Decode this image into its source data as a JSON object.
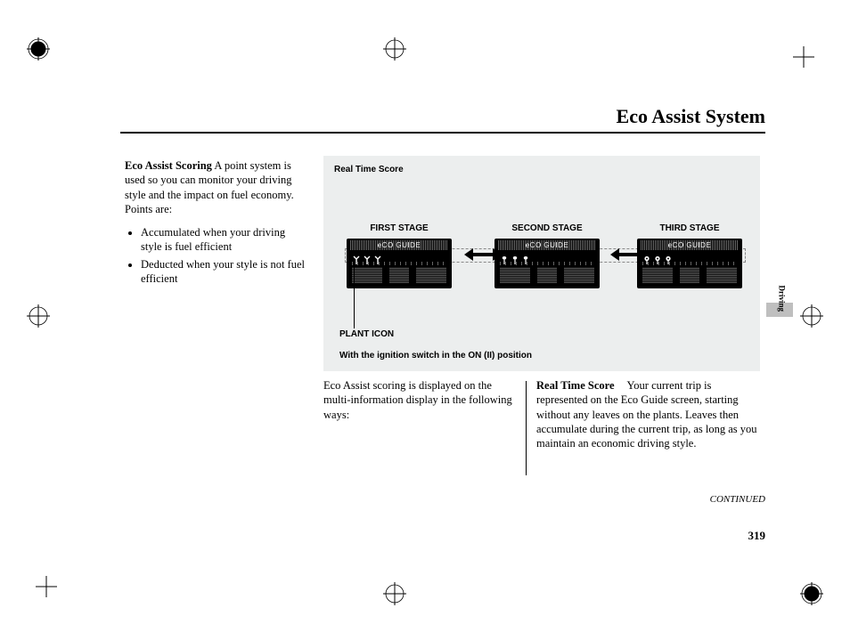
{
  "page": {
    "title": "Eco Assist System",
    "number": "319",
    "continued": "CONTINUED",
    "sideLabel": "Driving"
  },
  "left": {
    "heading": "Eco Assist Scoring",
    "intro": "A point system is used so you can monitor your driving style and the impact on fuel economy. Points are:",
    "bullets": [
      "Accumulated when your driving style is fuel efficient",
      "Deducted when your style is not fuel efficient"
    ]
  },
  "figure": {
    "title": "Real Time Score",
    "stages": [
      "FIRST STAGE",
      "SECOND STAGE",
      "THIRD STAGE"
    ],
    "guideLabel": "eCO GUIDE",
    "plantLabel": "PLANT ICON",
    "caption": "With the ignition switch in the ON (II) position"
  },
  "belowLeft": "Eco Assist scoring is displayed on the multi-information display in the following ways:",
  "belowRight": {
    "heading": "Real Time Score",
    "body": "Your current trip is represented on the Eco Guide screen, starting without any leaves on the plants. Leaves then accumulate during the current trip, as long as you maintain an economic driving style."
  }
}
